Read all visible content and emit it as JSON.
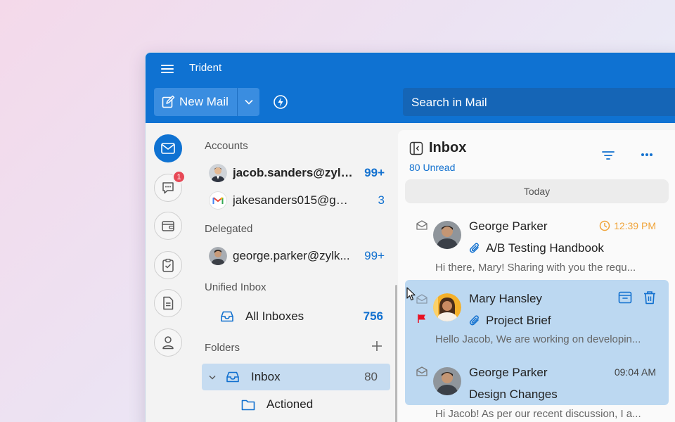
{
  "app": {
    "title": "Trident"
  },
  "toolbar": {
    "new_mail_label": "New Mail",
    "search_placeholder": "Search in Mail"
  },
  "rail": {
    "items": [
      {
        "name": "mail",
        "active": true
      },
      {
        "name": "chat",
        "badge": "1"
      },
      {
        "name": "wallet"
      },
      {
        "name": "tasks"
      },
      {
        "name": "notes"
      },
      {
        "name": "contacts"
      }
    ]
  },
  "folders": {
    "accounts_header": "Accounts",
    "accounts": [
      {
        "name": "jacob.sanders@zylk...",
        "count": "99+"
      },
      {
        "name": "jakesanders015@gm...",
        "count": "3"
      }
    ],
    "delegated_header": "Delegated",
    "delegated": [
      {
        "name": "george.parker@zylk...",
        "count": "99+"
      }
    ],
    "unified_header": "Unified Inbox",
    "all_inboxes": {
      "label": "All Inboxes",
      "count": "756"
    },
    "folders_header": "Folders",
    "inbox": {
      "label": "Inbox",
      "count": "80"
    },
    "actioned": {
      "label": "Actioned"
    }
  },
  "mail_list": {
    "title": "Inbox",
    "unread": "80 Unread",
    "group": "Today",
    "items": [
      {
        "from": "George Parker",
        "time": "12:39 PM",
        "subject": "A/B Testing Handbook",
        "preview": "Hi there, Mary! Sharing with you the requ..."
      },
      {
        "from": "Mary Hansley",
        "subject": "Project Brief",
        "preview": "Hello Jacob, We are working on developin..."
      },
      {
        "from": "George Parker",
        "time": "09:04 AM",
        "subject": "Design Changes",
        "preview": "Hi Jacob! As per our recent discussion, I a..."
      }
    ]
  },
  "colors": {
    "accent": "#0f72d2",
    "selected": "#bcd8f1",
    "reminder": "#f0a43a",
    "flag": "#e81123",
    "badge": "#e74856"
  }
}
